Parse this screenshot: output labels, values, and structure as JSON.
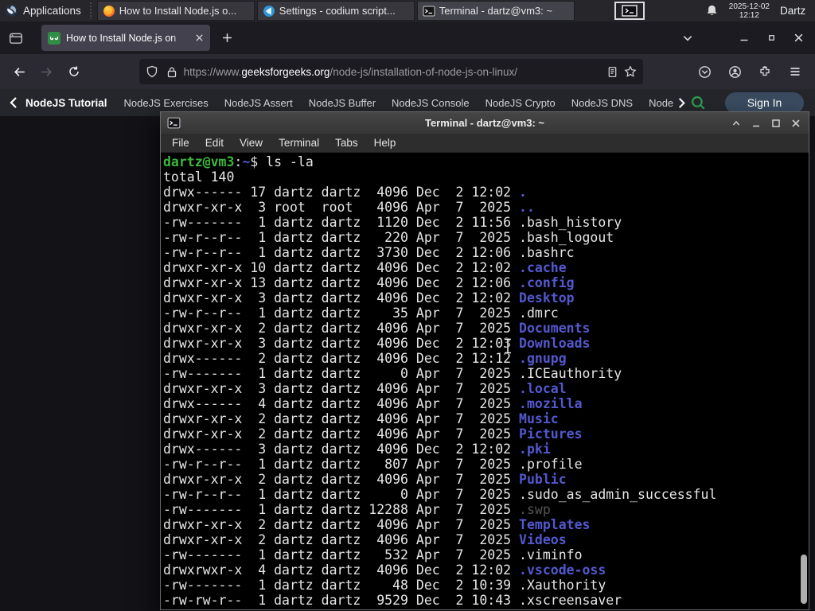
{
  "panel": {
    "applications_label": "Applications",
    "windows": [
      {
        "title": "How to Install Node.js o...",
        "app": "firefox"
      },
      {
        "title": "Settings - codium script...",
        "app": "codium"
      },
      {
        "title": "Terminal - dartz@vm3: ~",
        "app": "terminal"
      }
    ],
    "clock_date": "2025-12-02",
    "clock_time": "12:12",
    "user_label": "Dartz"
  },
  "browser": {
    "tab_title": "How to Install Node.js on",
    "url_scheme": "https://www.",
    "url_domain": "geeksforgeeks.org",
    "url_path": "/node-js/installation-of-node-js-on-linux/"
  },
  "gfg_nav": {
    "links": [
      "NodeJS Tutorial",
      "NodeJS Exercises",
      "NodeJS Assert",
      "NodeJS Buffer",
      "NodeJS Console",
      "NodeJS Crypto",
      "NodeJS DNS",
      "Node"
    ],
    "sign_in_label": "Sign In"
  },
  "terminal": {
    "title": "Terminal - dartz@vm3: ~",
    "menu": [
      "File",
      "Edit",
      "View",
      "Terminal",
      "Tabs",
      "Help"
    ],
    "prompt_user": "dartz@vm3",
    "prompt_separator": ":",
    "prompt_path": "~",
    "prompt_symbol": "$ ",
    "command": "ls -la",
    "total_line": "total 140",
    "colors": {
      "green": "#3cb83c",
      "blue": "#5458cf",
      "dim": "#555555",
      "text": "#e6e6e6"
    },
    "entries": [
      {
        "perms": "drwx------",
        "links": 17,
        "owner": "dartz",
        "group": "dartz",
        "size": 4096,
        "month": "Dec",
        "day": 2,
        "time": "12:02",
        "name": ".",
        "color": "blue"
      },
      {
        "perms": "drwxr-xr-x",
        "links": 3,
        "owner": "root",
        "group": "root",
        "size": 4096,
        "month": "Apr",
        "day": 7,
        "time": "2025",
        "name": "..",
        "color": "blue"
      },
      {
        "perms": "-rw-------",
        "links": 1,
        "owner": "dartz",
        "group": "dartz",
        "size": 1120,
        "month": "Dec",
        "day": 2,
        "time": "11:56",
        "name": ".bash_history",
        "color": "white"
      },
      {
        "perms": "-rw-r--r--",
        "links": 1,
        "owner": "dartz",
        "group": "dartz",
        "size": 220,
        "month": "Apr",
        "day": 7,
        "time": "2025",
        "name": ".bash_logout",
        "color": "white"
      },
      {
        "perms": "-rw-r--r--",
        "links": 1,
        "owner": "dartz",
        "group": "dartz",
        "size": 3730,
        "month": "Dec",
        "day": 2,
        "time": "12:06",
        "name": ".bashrc",
        "color": "white"
      },
      {
        "perms": "drwxr-xr-x",
        "links": 10,
        "owner": "dartz",
        "group": "dartz",
        "size": 4096,
        "month": "Dec",
        "day": 2,
        "time": "12:02",
        "name": ".cache",
        "color": "blue"
      },
      {
        "perms": "drwxr-xr-x",
        "links": 13,
        "owner": "dartz",
        "group": "dartz",
        "size": 4096,
        "month": "Dec",
        "day": 2,
        "time": "12:06",
        "name": ".config",
        "color": "blue"
      },
      {
        "perms": "drwxr-xr-x",
        "links": 3,
        "owner": "dartz",
        "group": "dartz",
        "size": 4096,
        "month": "Dec",
        "day": 2,
        "time": "12:02",
        "name": "Desktop",
        "color": "blue"
      },
      {
        "perms": "-rw-r--r--",
        "links": 1,
        "owner": "dartz",
        "group": "dartz",
        "size": 35,
        "month": "Apr",
        "day": 7,
        "time": "2025",
        "name": ".dmrc",
        "color": "white"
      },
      {
        "perms": "drwxr-xr-x",
        "links": 2,
        "owner": "dartz",
        "group": "dartz",
        "size": 4096,
        "month": "Apr",
        "day": 7,
        "time": "2025",
        "name": "Documents",
        "color": "blue"
      },
      {
        "perms": "drwxr-xr-x",
        "links": 3,
        "owner": "dartz",
        "group": "dartz",
        "size": 4096,
        "month": "Dec",
        "day": 2,
        "time": "12:03",
        "name": "Downloads",
        "color": "blue"
      },
      {
        "perms": "drwx------",
        "links": 2,
        "owner": "dartz",
        "group": "dartz",
        "size": 4096,
        "month": "Dec",
        "day": 2,
        "time": "12:12",
        "name": ".gnupg",
        "color": "blue"
      },
      {
        "perms": "-rw-------",
        "links": 1,
        "owner": "dartz",
        "group": "dartz",
        "size": 0,
        "month": "Apr",
        "day": 7,
        "time": "2025",
        "name": ".ICEauthority",
        "color": "white"
      },
      {
        "perms": "drwxr-xr-x",
        "links": 3,
        "owner": "dartz",
        "group": "dartz",
        "size": 4096,
        "month": "Apr",
        "day": 7,
        "time": "2025",
        "name": ".local",
        "color": "blue"
      },
      {
        "perms": "drwx------",
        "links": 4,
        "owner": "dartz",
        "group": "dartz",
        "size": 4096,
        "month": "Apr",
        "day": 7,
        "time": "2025",
        "name": ".mozilla",
        "color": "blue"
      },
      {
        "perms": "drwxr-xr-x",
        "links": 2,
        "owner": "dartz",
        "group": "dartz",
        "size": 4096,
        "month": "Apr",
        "day": 7,
        "time": "2025",
        "name": "Music",
        "color": "blue"
      },
      {
        "perms": "drwxr-xr-x",
        "links": 2,
        "owner": "dartz",
        "group": "dartz",
        "size": 4096,
        "month": "Apr",
        "day": 7,
        "time": "2025",
        "name": "Pictures",
        "color": "blue"
      },
      {
        "perms": "drwx------",
        "links": 3,
        "owner": "dartz",
        "group": "dartz",
        "size": 4096,
        "month": "Dec",
        "day": 2,
        "time": "12:02",
        "name": ".pki",
        "color": "blue"
      },
      {
        "perms": "-rw-r--r--",
        "links": 1,
        "owner": "dartz",
        "group": "dartz",
        "size": 807,
        "month": "Apr",
        "day": 7,
        "time": "2025",
        "name": ".profile",
        "color": "white"
      },
      {
        "perms": "drwxr-xr-x",
        "links": 2,
        "owner": "dartz",
        "group": "dartz",
        "size": 4096,
        "month": "Apr",
        "day": 7,
        "time": "2025",
        "name": "Public",
        "color": "blue"
      },
      {
        "perms": "-rw-r--r--",
        "links": 1,
        "owner": "dartz",
        "group": "dartz",
        "size": 0,
        "month": "Apr",
        "day": 7,
        "time": "2025",
        "name": ".sudo_as_admin_successful",
        "color": "white"
      },
      {
        "perms": "-rw-------",
        "links": 1,
        "owner": "dartz",
        "group": "dartz",
        "size": 12288,
        "month": "Apr",
        "day": 7,
        "time": "2025",
        "name": ".swp",
        "color": "dim"
      },
      {
        "perms": "drwxr-xr-x",
        "links": 2,
        "owner": "dartz",
        "group": "dartz",
        "size": 4096,
        "month": "Apr",
        "day": 7,
        "time": "2025",
        "name": "Templates",
        "color": "blue"
      },
      {
        "perms": "drwxr-xr-x",
        "links": 2,
        "owner": "dartz",
        "group": "dartz",
        "size": 4096,
        "month": "Apr",
        "day": 7,
        "time": "2025",
        "name": "Videos",
        "color": "blue"
      },
      {
        "perms": "-rw-------",
        "links": 1,
        "owner": "dartz",
        "group": "dartz",
        "size": 532,
        "month": "Apr",
        "day": 7,
        "time": "2025",
        "name": ".viminfo",
        "color": "white"
      },
      {
        "perms": "drwxrwxr-x",
        "links": 4,
        "owner": "dartz",
        "group": "dartz",
        "size": 4096,
        "month": "Dec",
        "day": 2,
        "time": "12:02",
        "name": ".vscode-oss",
        "color": "blue"
      },
      {
        "perms": "-rw-------",
        "links": 1,
        "owner": "dartz",
        "group": "dartz",
        "size": 48,
        "month": "Dec",
        "day": 2,
        "time": "10:39",
        "name": ".Xauthority",
        "color": "white"
      },
      {
        "perms": "-rw-rw-r--",
        "links": 1,
        "owner": "dartz",
        "group": "dartz",
        "size": 9529,
        "month": "Dec",
        "day": 2,
        "time": "10:43",
        "name": ".xscreensaver",
        "color": "white"
      }
    ]
  }
}
